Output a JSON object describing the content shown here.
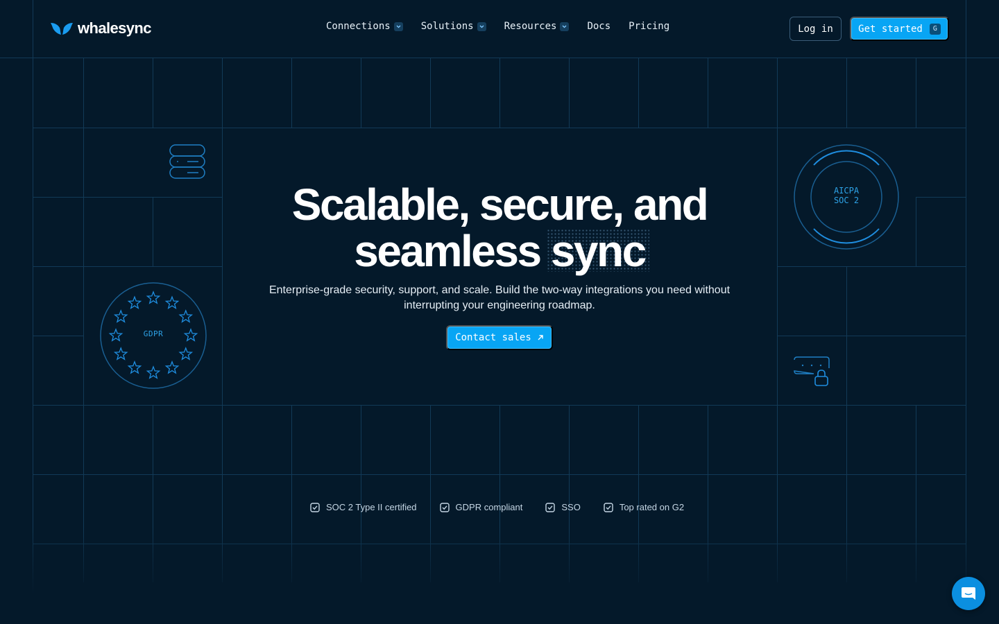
{
  "brand": {
    "name": "whalesync"
  },
  "nav": {
    "items": [
      {
        "label": "Connections",
        "dropdown": true
      },
      {
        "label": "Solutions",
        "dropdown": true
      },
      {
        "label": "Resources",
        "dropdown": true
      },
      {
        "label": "Docs",
        "dropdown": false
      },
      {
        "label": "Pricing",
        "dropdown": false
      }
    ],
    "login_label": "Log in",
    "get_started_label": "Get started",
    "get_started_shortcut": "G"
  },
  "hero": {
    "title_line1": "Scalable, secure, and",
    "title_line2": "seamless sync",
    "subtitle_line1": "Enterprise-grade security, support, and scale. Build the two-way integrations you need without",
    "subtitle_line2": "interrupting your engineering roadmap.",
    "cta_label": "Contact sales"
  },
  "badges": [
    "SOC 2 Type II certified",
    "GDPR compliant",
    "SSO",
    "Top rated on G2"
  ],
  "decor": {
    "gdpr_label": "GDPR",
    "aicpa_line1": "AICPA",
    "aicpa_line2": "SOC 2"
  },
  "colors": {
    "background": "#04192a",
    "accent": "#08a5f4",
    "grid_line": "#123a57",
    "decor_line": "#1f7fc4"
  },
  "icons": {
    "logo": "whale-tail-icon",
    "dropdown": "chevron-down-icon",
    "cta": "arrow-up-right-icon",
    "badge": "checkbox-checked-icon",
    "chat": "chat-bubble-icon"
  }
}
